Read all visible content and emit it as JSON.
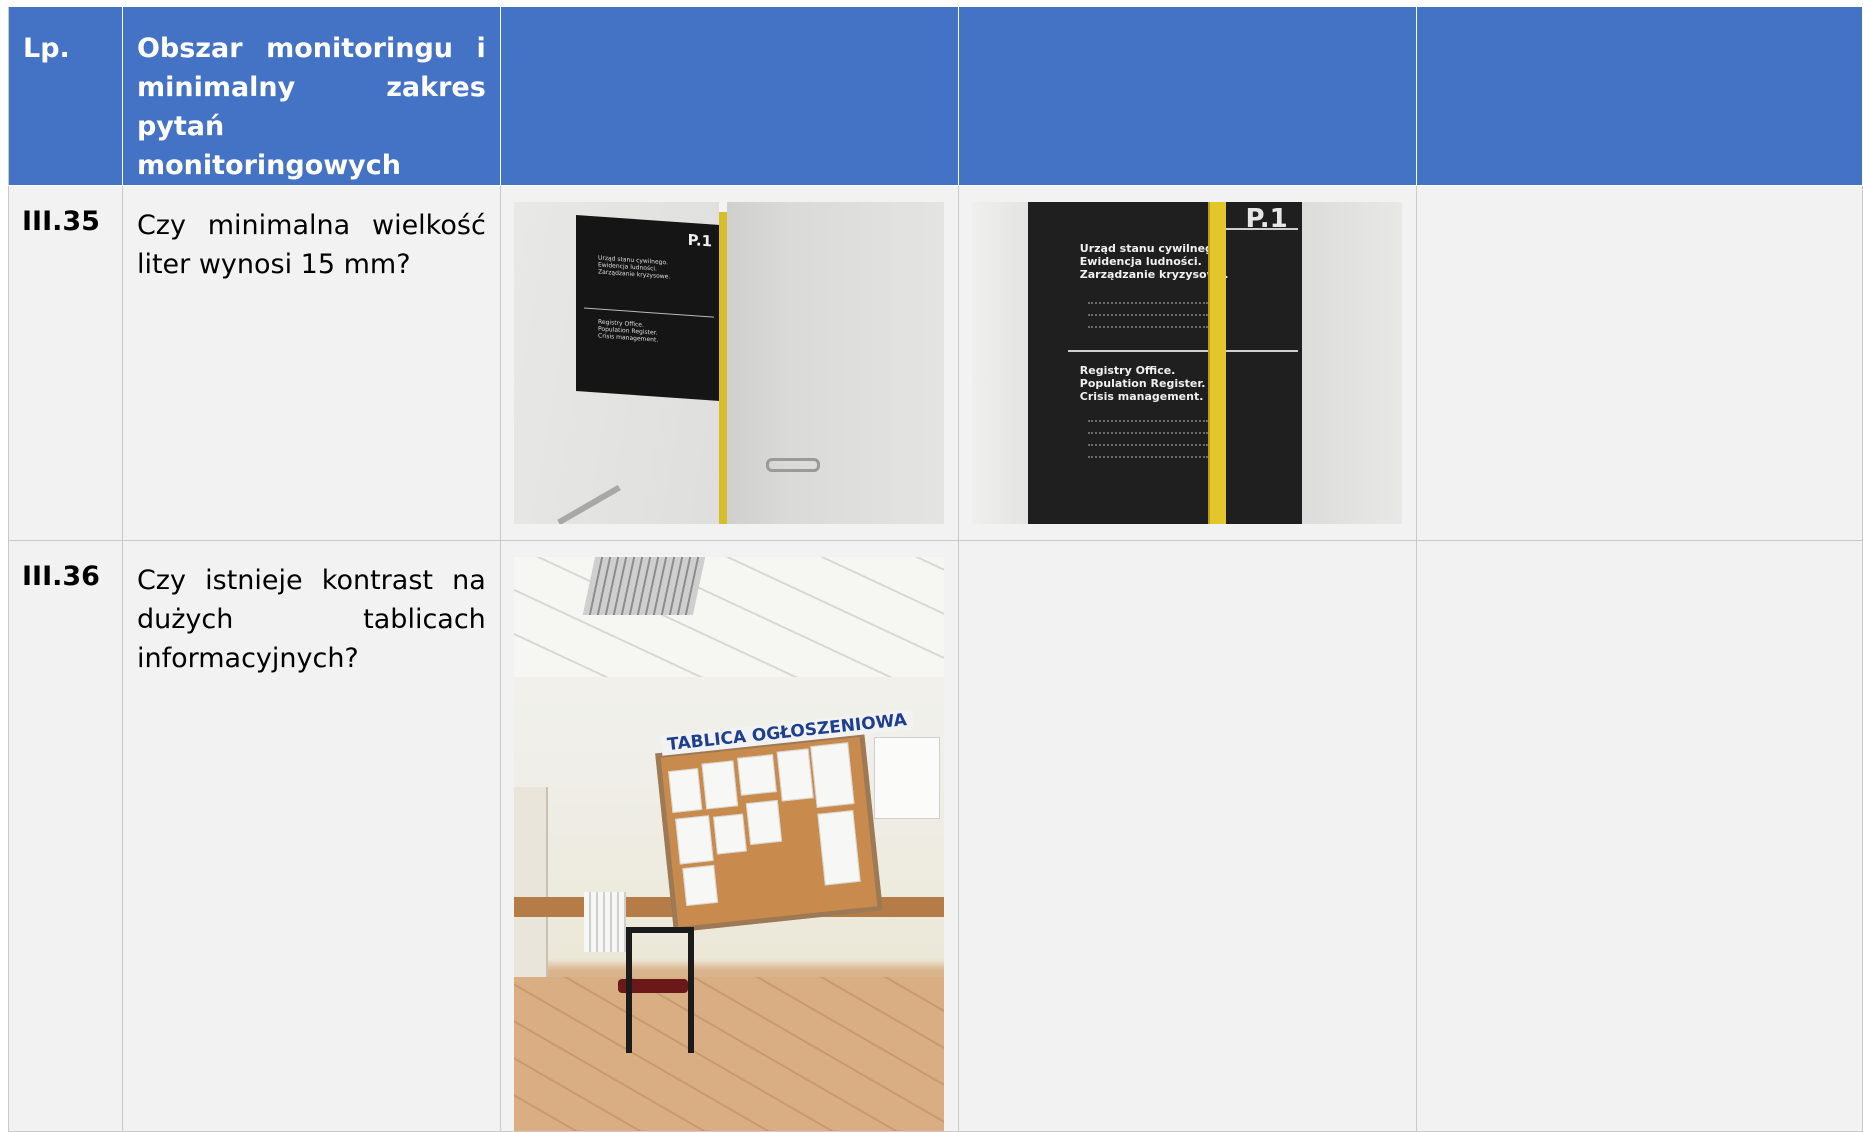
{
  "header": {
    "col1": "Lp.",
    "col2": "Obszar monitoringu i minimalny zakres pytań monitoringowych",
    "col3": "",
    "col4": "",
    "col5": ""
  },
  "rows": [
    {
      "lp": "III.35",
      "question": "Czy minimalna wielkość liter wynosi 15 mm?"
    },
    {
      "lp": "III.36",
      "question": "Czy istnieje kontrast na dużych tablicach informacyjnych?"
    }
  ],
  "photos": {
    "sign_small": {
      "label": "P.1",
      "lines_pl": [
        "Urząd stanu cywilnego.",
        "Ewidencja ludności.",
        "Zarządzanie kryzysowe."
      ],
      "lines_en": [
        "Registry Office.",
        "Population Register.",
        "Crisis management."
      ]
    },
    "sign_close": {
      "label": "P.1",
      "lines_pl": [
        "Urząd stanu cywilnego.",
        "Ewidencja ludności.",
        "Zarządzanie kryzysowe."
      ],
      "lines_en": [
        "Registry Office.",
        "Population Register.",
        "Crisis management."
      ]
    },
    "board": {
      "title": "TABLICA OGŁOSZENIOWA"
    }
  },
  "colors": {
    "header_bg": "#4472c4",
    "header_text": "#ffffff",
    "cell_bg": "#f2f2f2",
    "border": "#c9c9c9"
  }
}
